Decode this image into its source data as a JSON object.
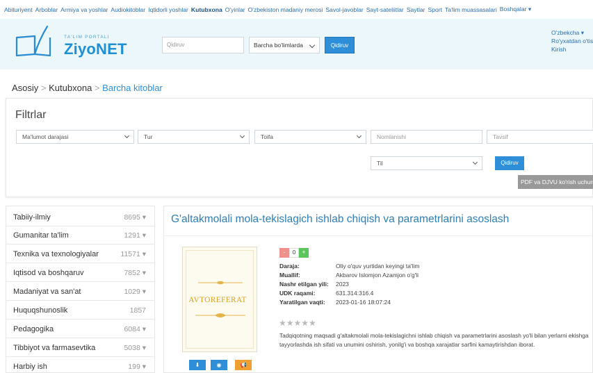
{
  "topnav": {
    "items": [
      "Abituriyent",
      "Arboblar",
      "Armiya va yoshlar",
      "Audiokitoblar",
      "Iqtidorli yoshlar",
      "Kutubxona",
      "O'yinlar",
      "O'zbekiston madaniy merosi",
      "Savol-javoblar",
      "Sayt-sateliitlar",
      "Saytlar",
      "Sport",
      "Ta'lim muassasalari",
      "Boshqalar ▾"
    ],
    "active_index": 5
  },
  "header": {
    "logo_small": "TA'LIM PORTALI",
    "logo_big": "ZiyoNET",
    "search_placeholder": "Qidiruv",
    "scope_select": "Barcha bo'limlarda",
    "search_button": "Qidiruv",
    "language": "O'zbekcha ▾",
    "register": "Ro'yxatdan o'tish",
    "login": "Kirish"
  },
  "breadcrumb": {
    "home": "Asosiy",
    "library": "Kutubxona",
    "current": "Barcha kitoblar"
  },
  "filters": {
    "title": "Filtrlar",
    "level_select": "Ma'lumot darajasi",
    "type_select": "Tur",
    "category_select": "Toifa",
    "name_placeholder": "Nomlanishi",
    "desc_placeholder": "Tavsif",
    "lang_select": "Til",
    "search_button": "Qidiruv",
    "pdf_note": "PDF va DJVU ko'rish uchun"
  },
  "sidebar": {
    "items": [
      {
        "label": "Tabiiy-ilmiy",
        "count": "8695 ▾"
      },
      {
        "label": "Gumanitar ta'lim",
        "count": "1291 ▾"
      },
      {
        "label": "Texnika va texnologiyalar",
        "count": "11571 ▾"
      },
      {
        "label": "Iqtisod va boshqaruv",
        "count": "7852 ▾"
      },
      {
        "label": "Madaniyat va san'at",
        "count": "1029 ▾"
      },
      {
        "label": "Huquqshunoslik",
        "count": "1857"
      },
      {
        "label": "Pedagogika",
        "count": "6084 ▾"
      },
      {
        "label": "Tibbiyot va farmasevtika",
        "count": "5038 ▾"
      },
      {
        "label": "Harbiy ish",
        "count": "199 ▾"
      }
    ]
  },
  "book": {
    "title": "G'altakmolali mola-tekislagich ishlab chiqish va parametrlarini asoslash",
    "cover_text": "AVTOREFERAT",
    "votes": "0",
    "vote_minus": "-",
    "vote_plus": "+",
    "fields": [
      {
        "label": "Daraja:",
        "value": "Oliy o'quv yurtidan keyingi ta'lim"
      },
      {
        "label": "Muallif:",
        "value": "Akbarov Islomjon Azamjon o'g'li"
      },
      {
        "label": "Nashr etilgan yili:",
        "value": "2023"
      },
      {
        "label": "UDK raqami:",
        "value": "631.314:316.4"
      },
      {
        "label": "Yaratilgan vaqti:",
        "value": "2023-01-16 18:07:24"
      }
    ],
    "stars": "★★★★★",
    "rating": 0,
    "description": "Tadqiqotning maqsadi g'altakmolali mola-tekislagichni ishlab chiqish va parametrlarini asoslash yo'li bilan yerlarni ekishga tayyorlashda ish sifati va unumini oshirish, yonilg'i va boshqa xarajatlar sarfini kamaytirishdan iborat.",
    "buttons": [
      {
        "icon": "download-icon",
        "glyph": "⬇",
        "color": "#2e8fd8"
      },
      {
        "icon": "eye-icon",
        "glyph": "◉",
        "color": "#2e8fd8"
      },
      {
        "icon": "megaphone-icon",
        "glyph": "📢",
        "color": "#f0a030"
      }
    ]
  }
}
